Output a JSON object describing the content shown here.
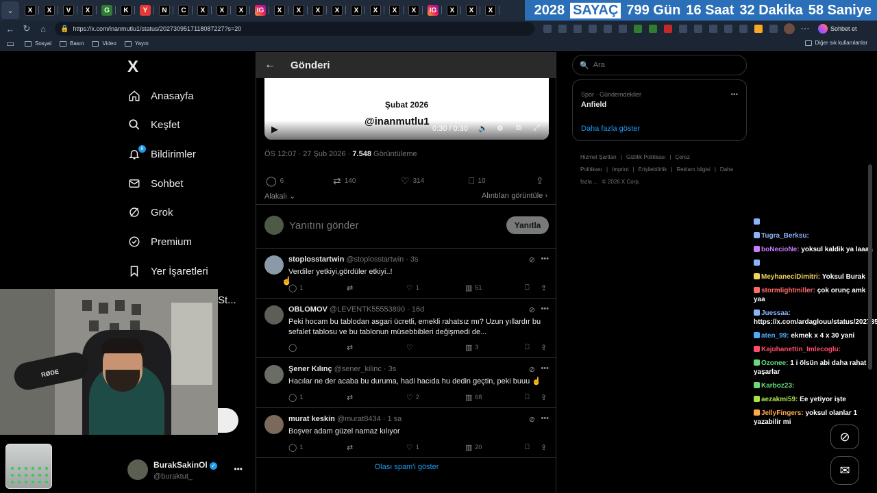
{
  "browser": {
    "tab_favicons": [
      "X",
      "X",
      "V",
      "X",
      "G",
      "K",
      "Y",
      "N",
      "C",
      "X",
      "X",
      "X",
      "IG",
      "X",
      "X",
      "X",
      "X",
      "X",
      "X",
      "X",
      "X",
      "IG",
      "X",
      "X",
      "X",
      "IG",
      "X",
      "X",
      "X",
      "X",
      "X",
      "IG",
      "X",
      "X"
    ],
    "url": "https://x.com/inanmutlu1/status/2027309517118087227?s=20",
    "copilot_label": "Sohbet et",
    "bookmarks": [
      "Sosyal",
      "Basın",
      "Video",
      "Yayın"
    ],
    "bookmarks_other": "Diğer sık kullanılanlar"
  },
  "counter": {
    "year": "2028",
    "label": "SAYAÇ",
    "days": "799 Gün",
    "hours": "16 Saat",
    "minutes": "32 Dakika",
    "seconds": "58 Saniye"
  },
  "nav": {
    "logo": "X",
    "items": [
      {
        "label": "Anasayfa",
        "icon": "home-icon"
      },
      {
        "label": "Keşfet",
        "icon": "search-icon"
      },
      {
        "label": "Bildirimler",
        "icon": "bell-icon",
        "badge": "8"
      },
      {
        "label": "Sohbet",
        "icon": "mail-icon"
      },
      {
        "label": "Grok",
        "icon": "grok-icon"
      },
      {
        "label": "Premium",
        "icon": "premium-icon"
      },
      {
        "label": "Yer İşaretleri",
        "icon": "bookmark-icon"
      }
    ],
    "partial_label": "St..."
  },
  "account": {
    "display_name": "BurakSakinOl",
    "handle": "@buraktut_"
  },
  "post": {
    "header_title": "Gönderi",
    "video": {
      "date_text": "Şubat 2026",
      "handle_text": "@inanmutlu1",
      "time": "0:30 / 0:30"
    },
    "meta_time": "ÖS 12:07 · 27 Şub 2026 · ",
    "views": "7.548",
    "views_label": " Görüntüleme",
    "replies": "6",
    "reposts": "140",
    "likes": "314",
    "bookmarks": "10",
    "sort_label": "Alakalı",
    "quotes_label": "Alıntıları görüntüle ›",
    "reply_placeholder": "Yanıtını gönder",
    "reply_button": "Yanıtla"
  },
  "replies": [
    {
      "name": "stoplosstartwin",
      "sub": "@stoplosstartwin · 3s",
      "text": "Verdiler yetkiyi,gördüler etkiyi..!",
      "replies": "1",
      "reposts": "",
      "likes": "1",
      "views": "51",
      "avatar_color": "#8a9aa8"
    },
    {
      "name": "OBLOMOV",
      "sub": "@LEVENTK55553890 · 16d",
      "text": "Peki hocam bu tablodan asgari ücretli, emekli rahatsız mı? Uzun yıllardır bu sefalet tablosu ve bu tablonun müsebbibleri değişmedi de...",
      "replies": "",
      "reposts": "",
      "likes": "",
      "views": "3",
      "avatar_color": "#5d5f57"
    },
    {
      "name": "Şener Kılınç",
      "sub": "@sener_kilinc · 3s",
      "text": "Hacılar ne der acaba bu duruma, hadi hacıda hu dedin geçtin, peki buuu ☝️",
      "replies": "1",
      "reposts": "",
      "likes": "2",
      "views": "68",
      "avatar_color": "#6a6d66"
    },
    {
      "name": "murat keskin",
      "sub": "@murat8434 · 1 sa",
      "text": "Boşver adam güzel namaz kılıyor",
      "replies": "1",
      "reposts": "",
      "likes": "1",
      "views": "20",
      "avatar_color": "#7b6a5c"
    }
  ],
  "spam_link": "Olası spam'i göster",
  "right": {
    "search_placeholder": "Ara",
    "trend_category": "Spor · Gündemdekiler",
    "trend_title": "Anfield",
    "show_more": "Daha fazla göster",
    "footer": [
      "Hizmet Şartları",
      "|",
      "Gizlilik Politikası",
      "|",
      "Çerez Politikası",
      "|",
      "Imprint",
      "|",
      "Erişilebilirlik",
      "|",
      "Reklam bilgisi",
      "|",
      "Daha fazla ...",
      "© 2026 X Corp."
    ]
  },
  "webcam": {
    "mic_label": "RØDE"
  },
  "chat": [
    {
      "user": "",
      "text": "",
      "user_color": "#8ab4f8"
    },
    {
      "user": "Tugra_Berksu:",
      "text": "",
      "user_color": "#8ab4f8"
    },
    {
      "user": "boNecioNe:",
      "text": "yoksul kaldik ya laaaa",
      "user_color": "#c77dff"
    },
    {
      "user": "",
      "text": "",
      "user_color": "#8ab4f8"
    },
    {
      "user": "MeyhaneciDimitri:",
      "text": "Yoksul Burak",
      "user_color": "#f4d35e"
    },
    {
      "user": "stormlightmiller:",
      "text": "çok orunç amk yaa",
      "user_color": "#ff6b6b"
    },
    {
      "user": "Juessaa:",
      "text": "https://x.com/ardaglouu/status/2027351691516154164",
      "user_color": "#8ab4f8"
    },
    {
      "user": "aten_99:",
      "text": "ekmek x 4 x 30 yani",
      "user_color": "#4dabf7"
    },
    {
      "user": "Kajuhanettin_Imlecoglu:",
      "text": "",
      "user_color": "#ff4d6d"
    },
    {
      "user": "Ozonee:",
      "text": "1 i ölsün abi daha rahat yaşarlar",
      "user_color": "#69db7c"
    },
    {
      "user": "Karboz23:",
      "text": "",
      "user_color": "#69db7c"
    },
    {
      "user": "aezakmi59:",
      "text": "Ee yetiyor işte",
      "user_color": "#a9e34b"
    },
    {
      "user": "JellyFingers:",
      "text": "yoksul olanlar 1 yazabilir mi",
      "user_color": "#ffa94d"
    }
  ]
}
